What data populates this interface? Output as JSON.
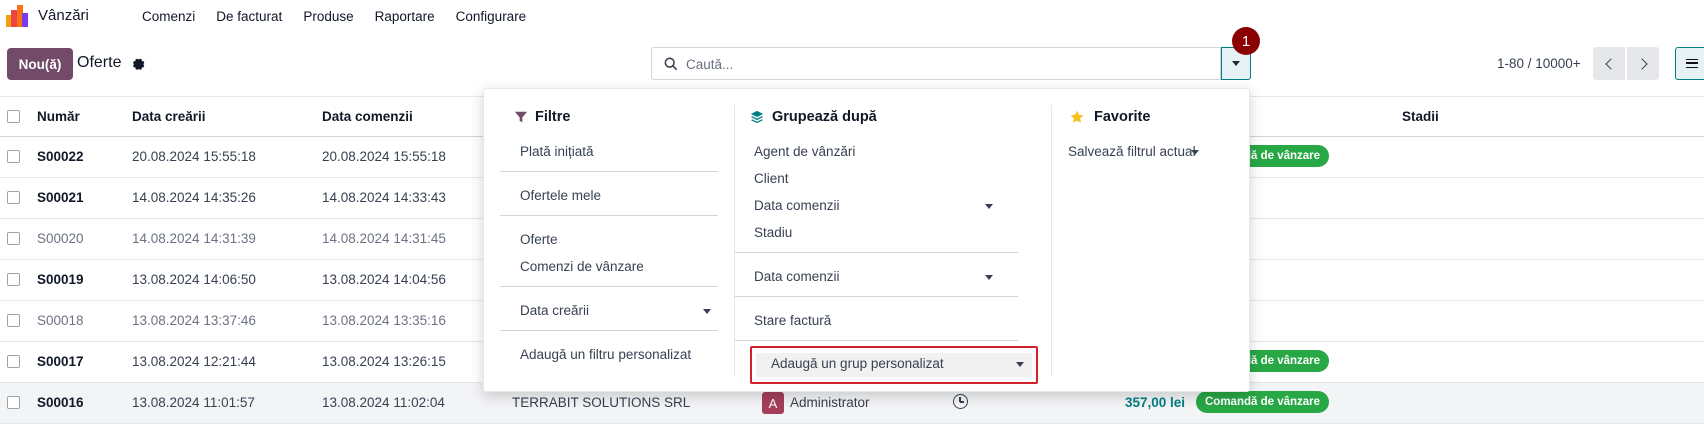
{
  "app": {
    "name": "Vânzări",
    "menu": [
      "Comenzi",
      "De facturat",
      "Produse",
      "Raportare",
      "Configurare"
    ]
  },
  "control": {
    "new_label": "Nou(ă)",
    "breadcrumb": "Oferte",
    "search_placeholder": "Caută...",
    "step_badge": "1",
    "pager": "1-80 / 10000+"
  },
  "table": {
    "headers": [
      "Număr",
      "Data creării",
      "Data comenzii",
      "Stadii"
    ],
    "rows": [
      {
        "number": "S00022",
        "created": "20.08.2024 15:55:18",
        "order": "20.08.2024 15:55:18",
        "status": "Comandă de vânzare",
        "muted": false
      },
      {
        "number": "S00021",
        "created": "14.08.2024 14:35:26",
        "order": "14.08.2024 14:33:43",
        "status": "",
        "muted": false
      },
      {
        "number": "S00020",
        "created": "14.08.2024 14:31:39",
        "order": "14.08.2024 14:31:45",
        "status": "",
        "muted": true
      },
      {
        "number": "S00019",
        "created": "13.08.2024 14:06:50",
        "order": "13.08.2024 14:04:56",
        "status": "",
        "muted": false
      },
      {
        "number": "S00018",
        "created": "13.08.2024 13:37:46",
        "order": "13.08.2024 13:35:16",
        "status": "",
        "muted": true
      },
      {
        "number": "S00017",
        "created": "13.08.2024 12:21:44",
        "order": "13.08.2024 13:26:15",
        "status": "Comandă de vânzare",
        "muted": false
      },
      {
        "number": "S00016",
        "created": "13.08.2024 11:01:57",
        "order": "13.08.2024 11:02:04",
        "status": "Comandă de vânzare",
        "muted": false,
        "customer": "TERRABIT SOLUTIONS SRL",
        "salesperson": "Administrator",
        "avatar_letter": "A",
        "amount": "357,00 lei"
      }
    ]
  },
  "filters": {
    "title": "Filtre",
    "groups": [
      [
        "Plată inițiată"
      ],
      [
        "Ofertele mele"
      ],
      [
        "Oferte",
        "Comenzi de vânzare"
      ],
      [
        "Data creării"
      ],
      [
        "Adaugă un filtru personalizat"
      ]
    ]
  },
  "groupby": {
    "title": "Grupează după",
    "items": [
      "Agent de vânzări",
      "Client",
      "Data comenzii",
      "Stadiu"
    ],
    "extra_date": "Data comenzii",
    "invoice": "Stare factură",
    "custom": "Adaugă un grup personalizat"
  },
  "favorites": {
    "title": "Favorite",
    "save": "Salvează filtrul actual"
  },
  "colors": {
    "brand": "#714b67",
    "accent": "#017e84",
    "success": "#28a745",
    "badge_step": "#8b0000",
    "highlight": "#d11f2c"
  }
}
